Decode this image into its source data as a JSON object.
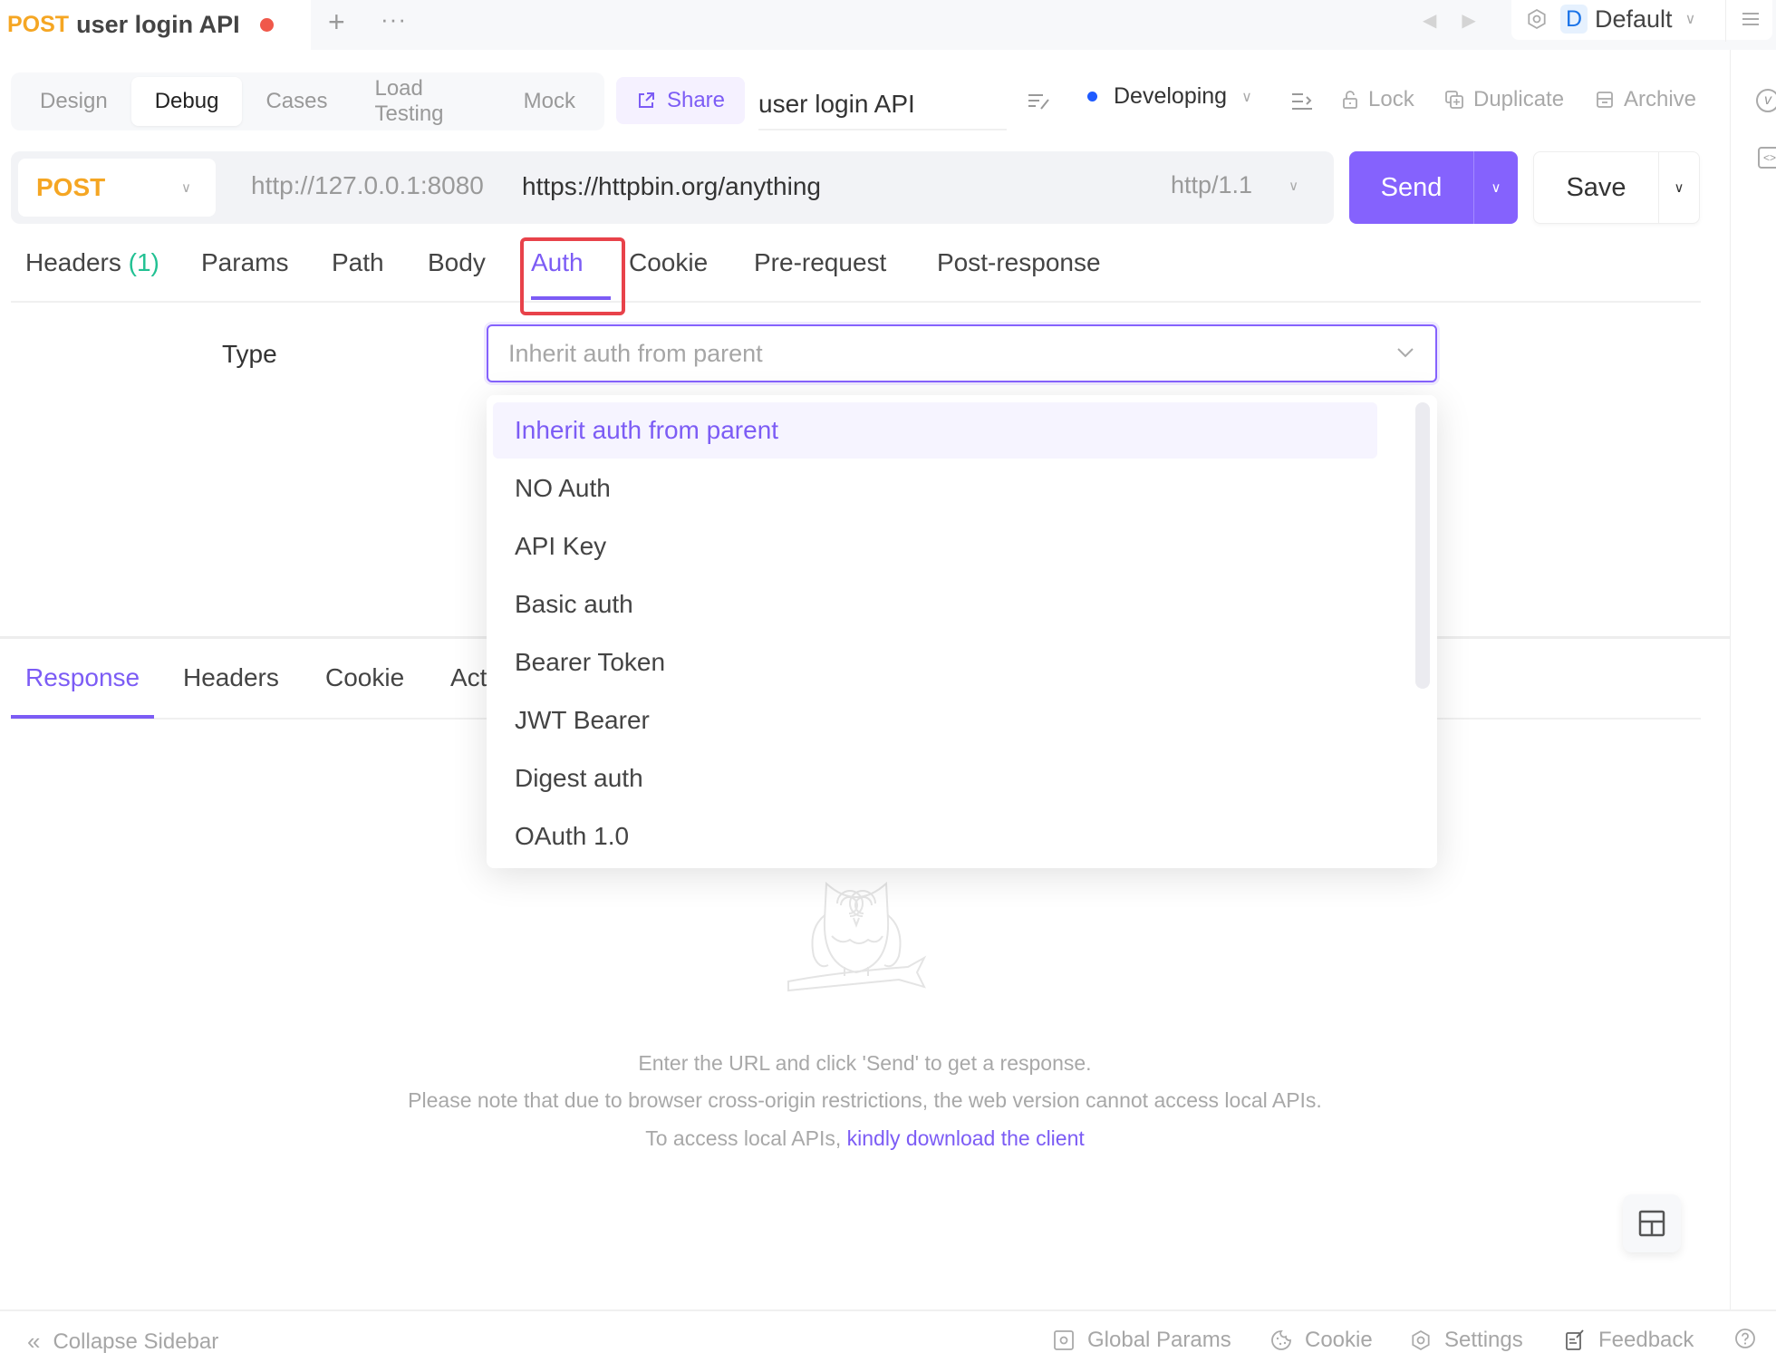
{
  "tabbar": {
    "doc_tab": {
      "method": "POST",
      "title": "user login API",
      "unsaved_indicator": true
    },
    "add_tab_icon": "+",
    "more_icon": "···",
    "nav_back_icon": "◀",
    "nav_forward_icon": "▶",
    "environment": {
      "badge": "D",
      "name": "Default"
    }
  },
  "mode_tabs": [
    {
      "label": "Design",
      "active": false
    },
    {
      "label": "Debug",
      "active": true
    },
    {
      "label": "Cases",
      "active": false
    },
    {
      "label": "Load Testing",
      "active": false
    },
    {
      "label": "Mock",
      "active": false
    }
  ],
  "toolbar": {
    "share_label": "Share",
    "api_name": "user login API",
    "status": {
      "label": "Developing",
      "color": "#1f5bff"
    },
    "lock_label": "Lock",
    "duplicate_label": "Duplicate",
    "archive_label": "Archive"
  },
  "request": {
    "method": "POST",
    "base_url": "http://127.0.0.1:8080",
    "url": "https://httpbin.org/anything",
    "http_version": "http/1.1",
    "send_label": "Send",
    "save_label": "Save"
  },
  "request_tabs": [
    {
      "label": "Headers",
      "count": "(1)",
      "active": false
    },
    {
      "label": "Params",
      "active": false
    },
    {
      "label": "Path",
      "active": false
    },
    {
      "label": "Body",
      "active": false
    },
    {
      "label": "Auth",
      "active": true
    },
    {
      "label": "Cookie",
      "active": false
    },
    {
      "label": "Pre-request",
      "active": false
    },
    {
      "label": "Post-response",
      "active": false
    }
  ],
  "auth": {
    "type_label": "Type",
    "placeholder": "Inherit auth from parent",
    "options": [
      {
        "label": "Inherit auth from parent",
        "selected": true
      },
      {
        "label": "NO Auth",
        "selected": false
      },
      {
        "label": "API Key",
        "selected": false
      },
      {
        "label": "Basic auth",
        "selected": false
      },
      {
        "label": "Bearer Token",
        "selected": false
      },
      {
        "label": "JWT Bearer",
        "selected": false
      },
      {
        "label": "Digest auth",
        "selected": false
      },
      {
        "label": "OAuth 1.0",
        "selected": false
      }
    ]
  },
  "response_tabs": [
    {
      "label": "Response",
      "active": true
    },
    {
      "label": "Headers",
      "active": false
    },
    {
      "label": "Cookie",
      "active": false
    },
    {
      "label": "Act",
      "active": false
    }
  ],
  "empty_state": {
    "line1": "Enter the URL and click 'Send' to get a response.",
    "line2": "Please note that due to browser cross-origin restrictions, the web version cannot access local APIs.",
    "line3_prefix": "To access local APIs, ",
    "line3_link": "kindly download the client"
  },
  "footer": {
    "collapse_label": "Collapse Sidebar",
    "global_params_label": "Global Params",
    "cookie_label": "Cookie",
    "settings_label": "Settings",
    "feedback_label": "Feedback"
  },
  "colors": {
    "accent": "#8562fd",
    "method_post": "#f5a623",
    "unsaved_dot": "#f0584a",
    "count_green": "#22c193",
    "highlight_red": "#e8424a"
  }
}
